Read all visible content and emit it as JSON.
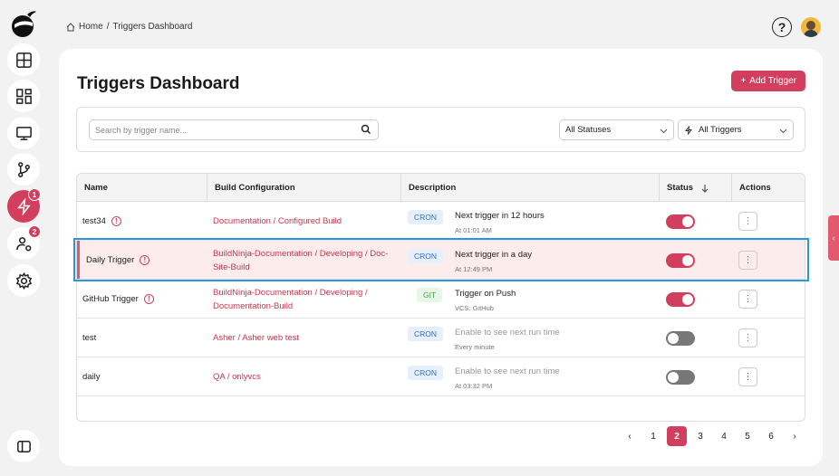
{
  "breadcrumb": {
    "home": "Home",
    "separator": "/",
    "current": "Triggers Dashboard"
  },
  "header": {
    "title": "Triggers Dashboard",
    "add_button": "Add Trigger"
  },
  "search": {
    "placeholder": "Search by trigger name..."
  },
  "filters": {
    "status": "All Statuses",
    "type": "All Triggers"
  },
  "sidebar": {
    "items": [
      {
        "icon": "layout-icon"
      },
      {
        "icon": "grid-icon"
      },
      {
        "icon": "monitor-icon"
      },
      {
        "icon": "git-branch-icon"
      },
      {
        "icon": "lightning-icon",
        "badge": "1",
        "active": true
      },
      {
        "icon": "user-settings-icon",
        "badge": "2"
      },
      {
        "icon": "gear-icon"
      }
    ]
  },
  "table": {
    "columns": {
      "name": "Name",
      "build": "Build Configuration",
      "description": "Description",
      "status": "Status",
      "actions": "Actions"
    },
    "rows": [
      {
        "name": "test34",
        "build1": "Documentation",
        "build2": "Configured Build",
        "build3": "",
        "type": "CRON",
        "desc": "Next trigger in 12 hours",
        "sub": "At 01:01 AM",
        "enabled": true,
        "warn": true
      },
      {
        "name": "Daily Trigger",
        "build1": "BuildNinja-Documentation",
        "build2": "Developing",
        "build3": "Doc-Site-Build",
        "type": "CRON",
        "desc": "Next trigger in a day",
        "sub": "At 12:49 PM",
        "enabled": true,
        "warn": true
      },
      {
        "name": "GitHub Trigger",
        "build1": "BuildNinja-Documentation",
        "build2": "Developing",
        "build3": "Documentation-Build",
        "type": "GIT",
        "desc": "Trigger on Push",
        "sub": "VCS: GitHub",
        "enabled": true,
        "warn": true
      },
      {
        "name": "test",
        "build1": "Asher",
        "build2": "Asher web test",
        "build3": "",
        "type": "CRON",
        "desc": "Enable to see next run time",
        "sub": "Every minute",
        "enabled": false,
        "warn": false
      },
      {
        "name": "daily",
        "build1": "QA",
        "build2": "onlyvcs",
        "build3": "",
        "type": "CRON",
        "desc": "Enable to see next run time",
        "sub": "At 03:32 PM",
        "enabled": false,
        "warn": false
      }
    ]
  },
  "pagination": {
    "prev": "‹",
    "next": "›",
    "pages": [
      "1",
      "2",
      "3",
      "4",
      "5",
      "6"
    ],
    "current": "2"
  },
  "colors": {
    "accent": "#d23f5e",
    "selection": "#2d95e0"
  }
}
